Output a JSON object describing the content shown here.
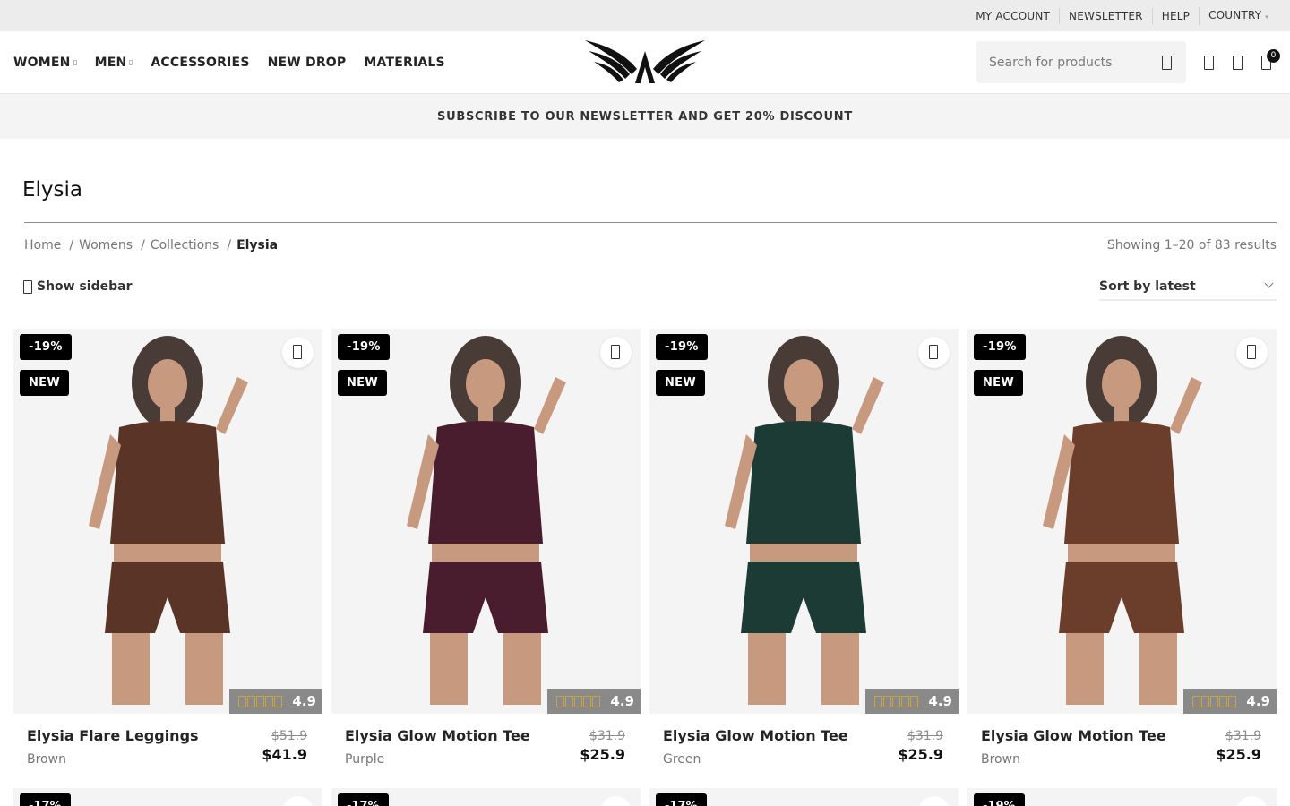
{
  "topbar": {
    "links": [
      "MY ACCOUNT",
      "NEWSLETTER",
      "HELP",
      "COUNTRY"
    ]
  },
  "header": {
    "nav": [
      "WOMEN",
      "MEN",
      "ACCESSORIES",
      "NEW DROP",
      "MATERIALS"
    ],
    "search_placeholder": "Search for products",
    "cart_count": "0"
  },
  "promo": {
    "text": "SUBSCRIBE TO OUR NEWSLETTER AND GET 20% DISCOUNT"
  },
  "page": {
    "title": "Elysia",
    "breadcrumb": [
      "Home",
      "Womens",
      "Collections",
      "Elysia"
    ],
    "results": "Showing 1–20 of 83 results",
    "show_sidebar": "Show sidebar",
    "sort": "Sort by latest"
  },
  "products": [
    {
      "discount": "-19%",
      "badge": "NEW",
      "rating": "4.9",
      "name": "Elysia Flare Leggings",
      "color": "Brown",
      "old_price": "$51.9",
      "price": "$41.9",
      "swatch": "#5a3426"
    },
    {
      "discount": "-19%",
      "badge": "NEW",
      "rating": "4.9",
      "name": "Elysia Glow Motion Tee",
      "color": "Purple",
      "old_price": "$31.9",
      "price": "$25.9",
      "swatch": "#4a1d2e"
    },
    {
      "discount": "-19%",
      "badge": "NEW",
      "rating": "4.9",
      "name": "Elysia Glow Motion Tee",
      "color": "Green",
      "old_price": "$31.9",
      "price": "$25.9",
      "swatch": "#1d3b35"
    },
    {
      "discount": "-19%",
      "badge": "NEW",
      "rating": "4.9",
      "name": "Elysia Glow Motion Tee",
      "color": "Brown",
      "old_price": "$31.9",
      "price": "$25.9",
      "swatch": "#6b3e2c"
    }
  ],
  "next_row_badges": [
    "-17%",
    "-17%",
    "-17%",
    "-19%"
  ]
}
